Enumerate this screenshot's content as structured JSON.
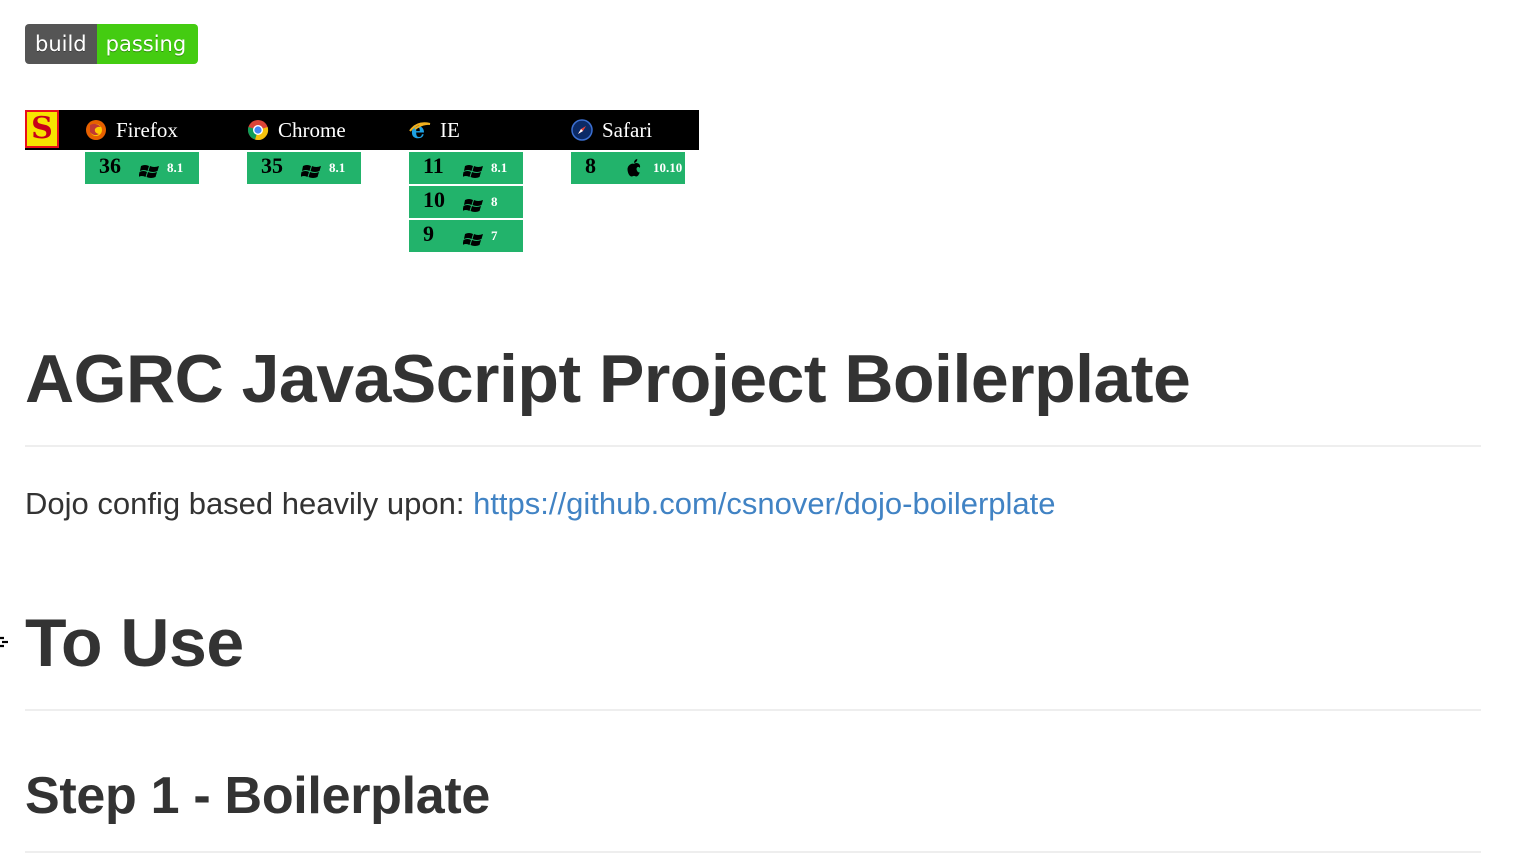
{
  "badge": {
    "left": "build",
    "right": "passing"
  },
  "sauce": {
    "logo_letter": "S",
    "browsers": [
      {
        "name": "Firefox",
        "icon": "firefox-icon",
        "versions": [
          {
            "version": "36",
            "os": "windows-icon",
            "os_version": "8.1"
          }
        ]
      },
      {
        "name": "Chrome",
        "icon": "chrome-icon",
        "versions": [
          {
            "version": "35",
            "os": "windows-icon",
            "os_version": "8.1"
          }
        ]
      },
      {
        "name": "IE",
        "icon": "ie-icon",
        "versions": [
          {
            "version": "11",
            "os": "windows-icon",
            "os_version": "8.1"
          },
          {
            "version": "10",
            "os": "windows-icon",
            "os_version": "8"
          },
          {
            "version": "9",
            "os": "windows-icon",
            "os_version": "7"
          }
        ]
      },
      {
        "name": "Safari",
        "icon": "safari-icon",
        "versions": [
          {
            "version": "8",
            "os": "apple-icon",
            "os_version": "10.10"
          }
        ]
      }
    ],
    "colors": {
      "header_bg": "#000000",
      "pass_bg": "#22b36b"
    }
  },
  "content": {
    "title": "AGRC JavaScript Project Boilerplate",
    "intro_text": "Dojo config based heavily upon: ",
    "intro_link": "https://github.com/csnover/dojo-boilerplate",
    "section_to_use": "To Use",
    "section_step1": "Step 1 - Boilerplate"
  },
  "colors": {
    "text": "#333333",
    "link": "#4183c4",
    "badge_dark": "#555555",
    "badge_green": "#44cc11"
  }
}
